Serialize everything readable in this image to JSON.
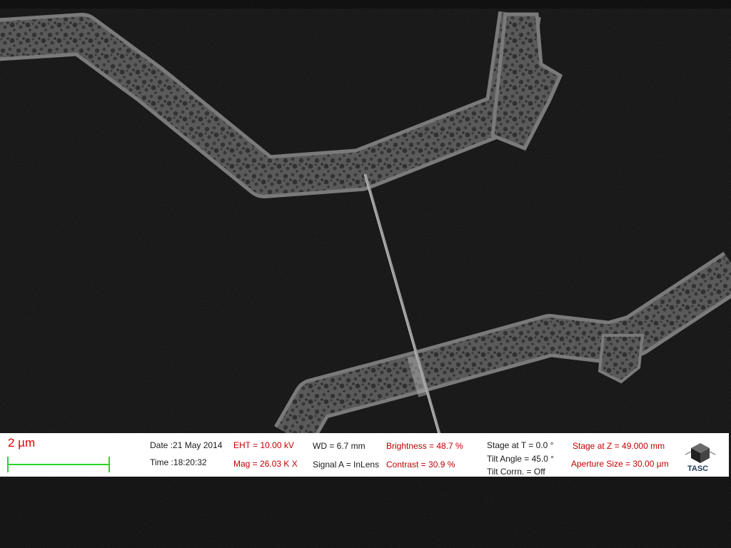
{
  "image": {
    "subject": "SEM micrograph",
    "background_color": "#0b0b0b",
    "line_color": "#9a9a9a"
  },
  "databar": {
    "scale_label": "2 µm",
    "scale_color": "#e00000",
    "scale_bar_color": "#2bd62b",
    "date_label": "Date :21 May 2014",
    "time_label": "Time :18:20:32",
    "eht_label": "EHT = 10.00 kV",
    "mag_label": "Mag =  26.03 K X",
    "wd_label": "WD =  6.7 mm",
    "signal_label": "Signal A = InLens",
    "brightness_label": "Brightness =  48.7 %",
    "contrast_label": "Contrast =  30.9 %",
    "stage_t_label": "Stage at T =    0.0 °",
    "tilt_angle_label": "Tilt Angle =  45.0 °",
    "tilt_corrn_label": "Tilt Corrn. = Off",
    "stage_z_label": "Stage at Z = 49.000 mm",
    "aperture_label": "Aperture Size = 30.00 µm",
    "logo_text": "TASC",
    "logo_icon": "cube-logo-icon"
  }
}
